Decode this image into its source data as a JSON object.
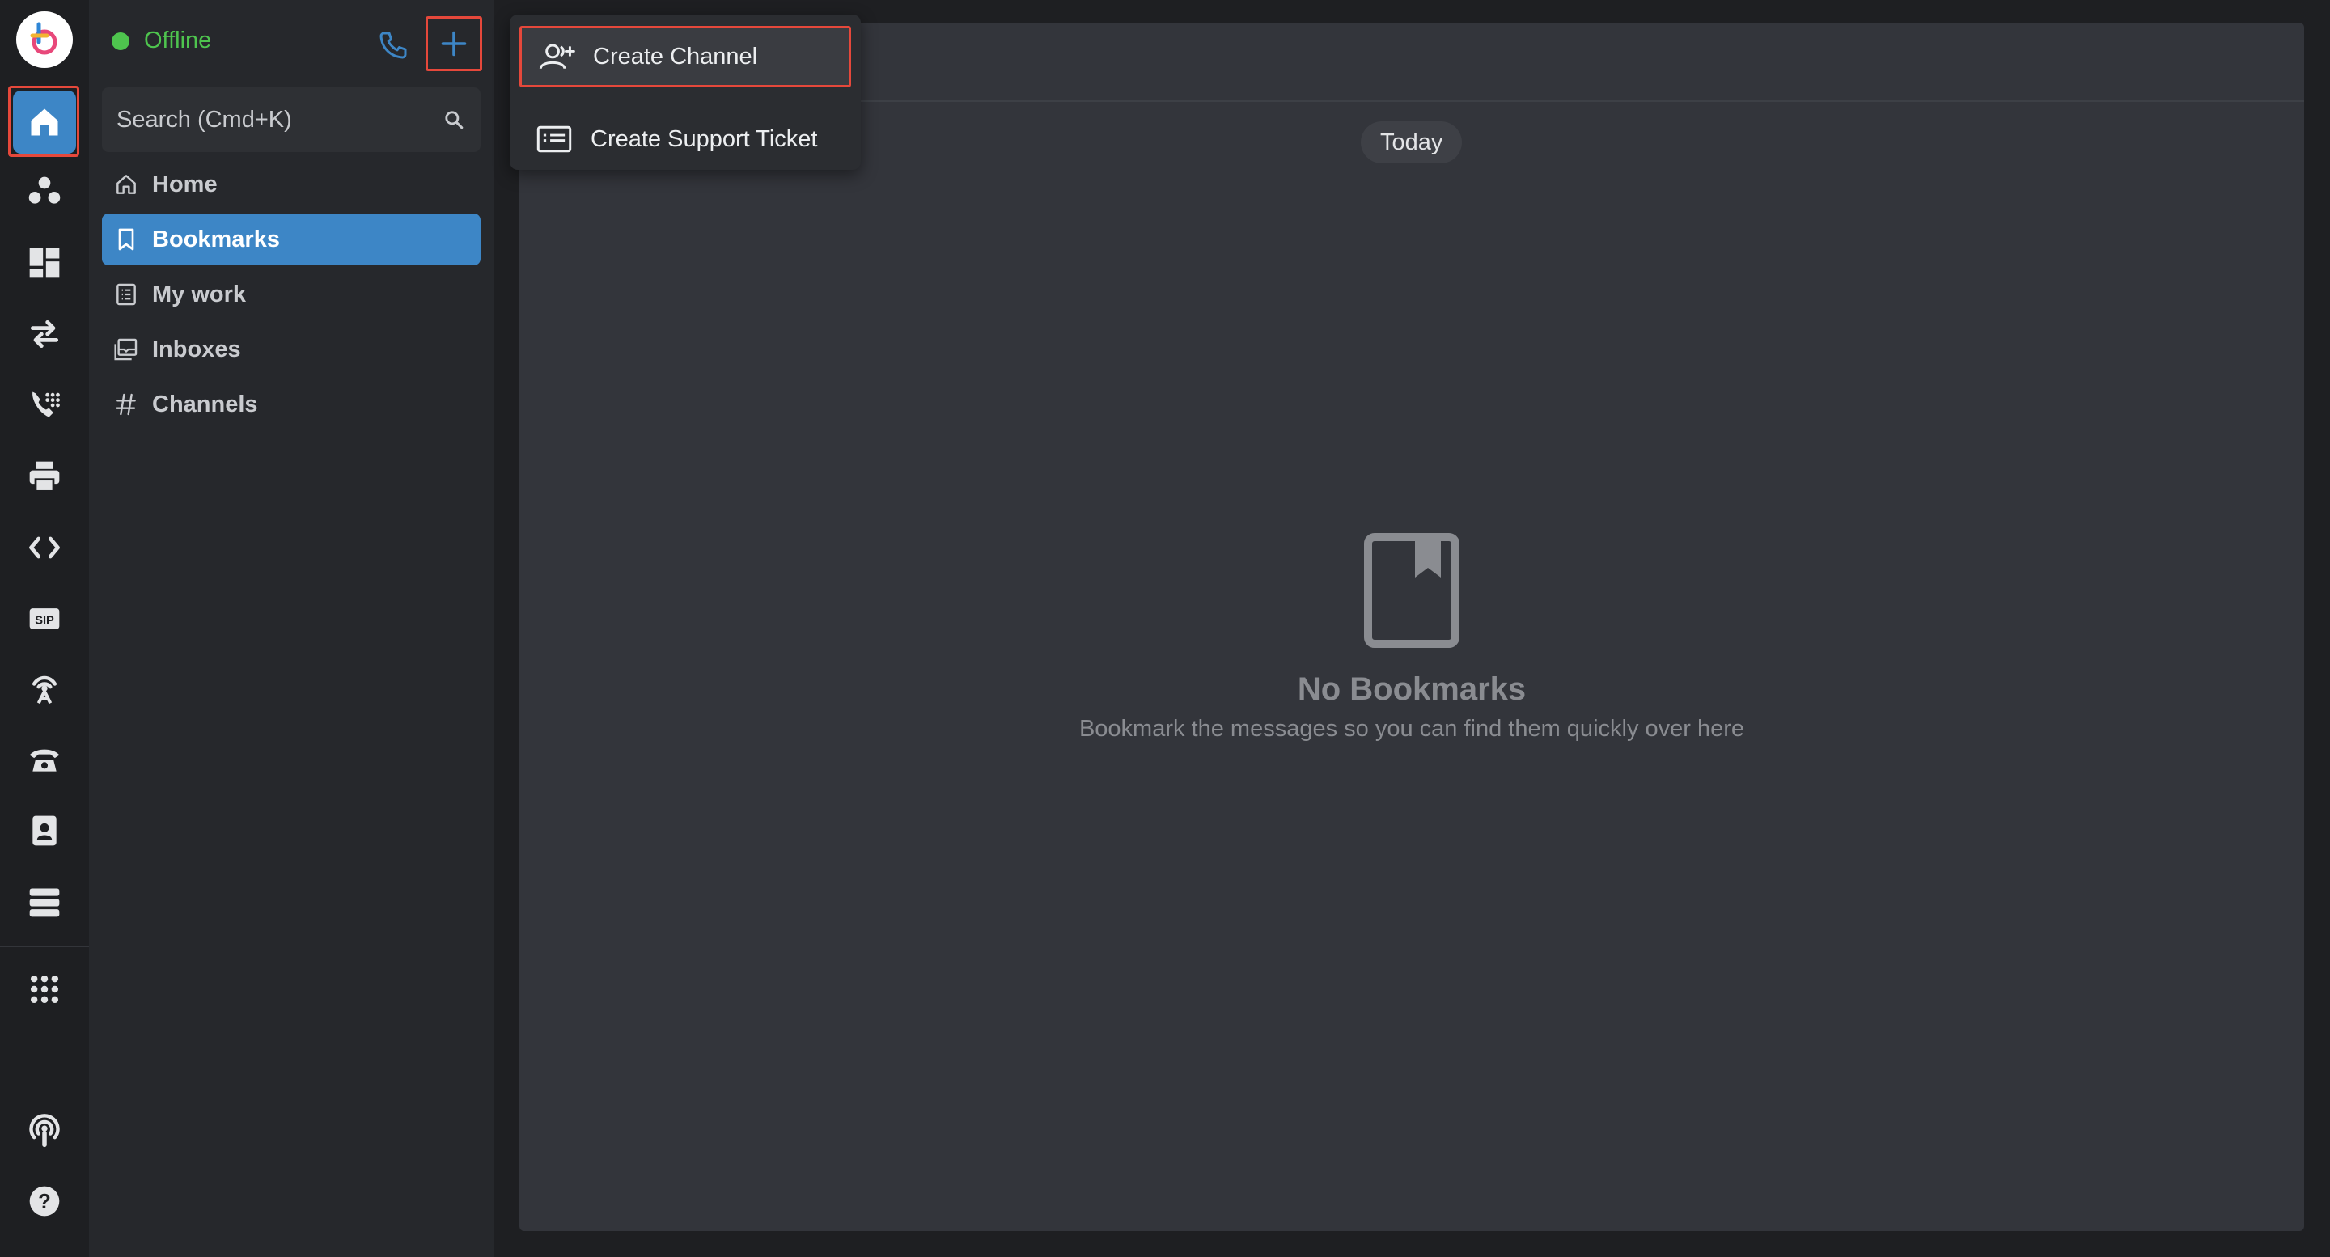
{
  "rail": {
    "items": [
      {
        "name": "home",
        "icon": "home-icon",
        "active": true
      },
      {
        "name": "teams",
        "icon": "teams-icon"
      },
      {
        "name": "dashboard",
        "icon": "dashboard-icon"
      },
      {
        "name": "transfer",
        "icon": "transfer-icon"
      },
      {
        "name": "call-dialpad",
        "icon": "phone-dialpad-icon"
      },
      {
        "name": "print",
        "icon": "printer-icon"
      },
      {
        "name": "code",
        "icon": "code-icon"
      },
      {
        "name": "sip",
        "icon": "sip-icon",
        "label": "SIP"
      },
      {
        "name": "broadcast",
        "icon": "antenna-icon"
      },
      {
        "name": "telephone",
        "icon": "telephone-icon"
      },
      {
        "name": "contacts",
        "icon": "contact-book-icon"
      },
      {
        "name": "servers",
        "icon": "server-icon"
      },
      {
        "name": "apps",
        "icon": "apps-grid-icon"
      },
      {
        "name": "podcast",
        "icon": "podcast-icon"
      },
      {
        "name": "help",
        "icon": "help-icon"
      }
    ]
  },
  "sidebar": {
    "status_label": "Offline",
    "search_placeholder": "Search (Cmd+K)",
    "nav": [
      {
        "label": "Home",
        "icon": "home-outline-icon"
      },
      {
        "label": "Bookmarks",
        "icon": "bookmark-icon",
        "active": true
      },
      {
        "label": "My work",
        "icon": "list-icon"
      },
      {
        "label": "Inboxes",
        "icon": "inbox-icon"
      },
      {
        "label": "Channels",
        "icon": "hash-icon"
      }
    ]
  },
  "dropdown": {
    "items": [
      {
        "label": "Create Channel",
        "icon": "add-user-icon"
      },
      {
        "label": "Create Support Ticket",
        "icon": "ticket-icon"
      }
    ]
  },
  "main": {
    "date_divider": "Today",
    "empty_title": "No Bookmarks",
    "empty_subtitle": "Bookmark the messages so you can find them quickly over here"
  },
  "colors": {
    "accent": "#3d86c6",
    "online_status": "#4ec44e",
    "highlight_box": "#e5483b",
    "rail_bg": "#1e1f22",
    "sidebar_bg": "#26282c",
    "main_bg": "#33353b"
  }
}
